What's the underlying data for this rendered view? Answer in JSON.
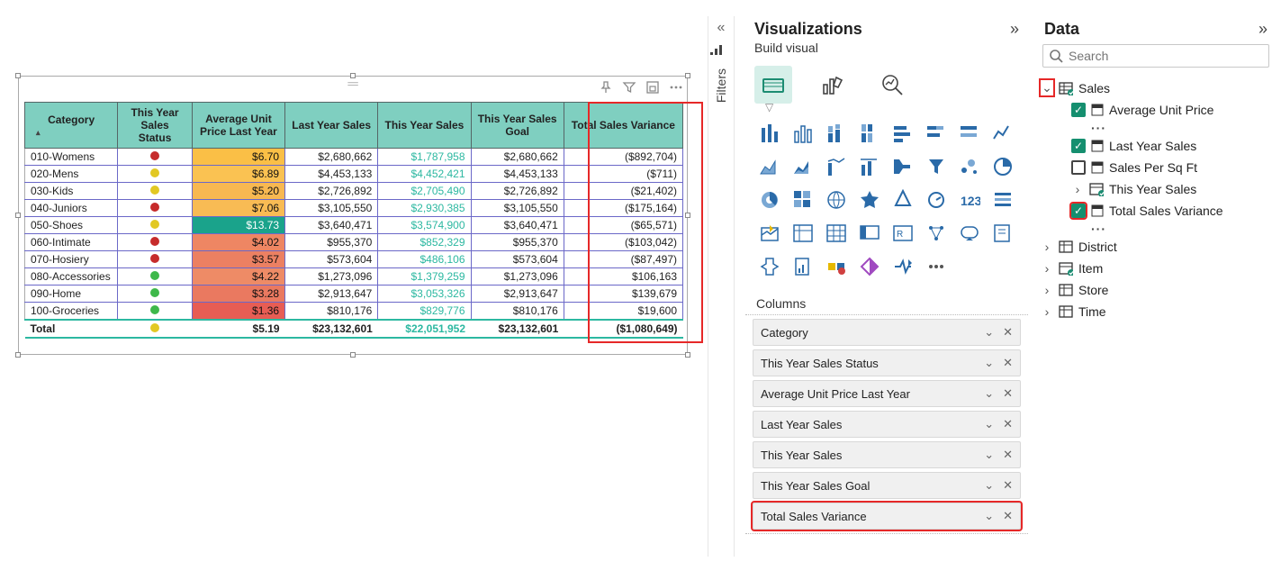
{
  "filters_label": "Filters",
  "viz": {
    "title": "Visualizations",
    "sub": "Build visual",
    "section": "Columns",
    "columns": [
      "Category",
      "This Year Sales Status",
      "Average Unit Price Last Year",
      "Last Year Sales",
      "This Year Sales",
      "This Year Sales Goal",
      "Total Sales Variance"
    ]
  },
  "data": {
    "title": "Data",
    "search_ph": "Search",
    "tables": {
      "sales": {
        "name": "Sales",
        "fields": {
          "avg_price": "Average Unit Price",
          "last_year": "Last Year Sales",
          "per_sqft": "Sales Per Sq Ft",
          "this_year": "This Year Sales",
          "variance": "Total Sales Variance"
        }
      },
      "district": "District",
      "item": "Item",
      "store": "Store",
      "time": "Time"
    }
  },
  "table": {
    "headers": [
      "Category",
      "This Year Sales Status",
      "Average Unit Price Last Year",
      "Last Year Sales",
      "This Year Sales",
      "This Year Sales Goal",
      "Total Sales Variance"
    ],
    "rows": [
      {
        "cat": "010-Womens",
        "status": "red",
        "avg": "$6.70",
        "avgcls": "avg-bg-1",
        "ly": "$2,680,662",
        "ty": "$1,787,958",
        "goal": "$2,680,662",
        "var": "($892,704)"
      },
      {
        "cat": "020-Mens",
        "status": "yel",
        "avg": "$6.89",
        "avgcls": "avg-bg-2",
        "ly": "$4,453,133",
        "ty": "$4,452,421",
        "goal": "$4,453,133",
        "var": "($711)"
      },
      {
        "cat": "030-Kids",
        "status": "yel",
        "avg": "$5.20",
        "avgcls": "avg-bg-3",
        "ly": "$2,726,892",
        "ty": "$2,705,490",
        "goal": "$2,726,892",
        "var": "($21,402)"
      },
      {
        "cat": "040-Juniors",
        "status": "red",
        "avg": "$7.06",
        "avgcls": "avg-bg-4",
        "ly": "$3,105,550",
        "ty": "$2,930,385",
        "goal": "$3,105,550",
        "var": "($175,164)"
      },
      {
        "cat": "050-Shoes",
        "status": "yel",
        "avg": "$13.73",
        "avgcls": "avg-bg-5",
        "ly": "$3,640,471",
        "ty": "$3,574,900",
        "goal": "$3,640,471",
        "var": "($65,571)"
      },
      {
        "cat": "060-Intimate",
        "status": "red",
        "avg": "$4.02",
        "avgcls": "avg-bg-6",
        "ly": "$955,370",
        "ty": "$852,329",
        "goal": "$955,370",
        "var": "($103,042)"
      },
      {
        "cat": "070-Hosiery",
        "status": "red",
        "avg": "$3.57",
        "avgcls": "avg-bg-7",
        "ly": "$573,604",
        "ty": "$486,106",
        "goal": "$573,604",
        "var": "($87,497)"
      },
      {
        "cat": "080-Accessories",
        "status": "grn",
        "avg": "$4.22",
        "avgcls": "avg-bg-8",
        "ly": "$1,273,096",
        "ty": "$1,379,259",
        "goal": "$1,273,096",
        "var": "$106,163"
      },
      {
        "cat": "090-Home",
        "status": "grn",
        "avg": "$3.28",
        "avgcls": "avg-bg-9",
        "ly": "$2,913,647",
        "ty": "$3,053,326",
        "goal": "$2,913,647",
        "var": "$139,679"
      },
      {
        "cat": "100-Groceries",
        "status": "grn",
        "avg": "$1.36",
        "avgcls": "avg-bg-10",
        "ly": "$810,176",
        "ty": "$829,776",
        "goal": "$810,176",
        "var": "$19,600"
      }
    ],
    "total": {
      "cat": "Total",
      "status": "yel",
      "avg": "$5.19",
      "ly": "$23,132,601",
      "ty": "$22,051,952",
      "goal": "$23,132,601",
      "var": "($1,080,649)"
    }
  }
}
